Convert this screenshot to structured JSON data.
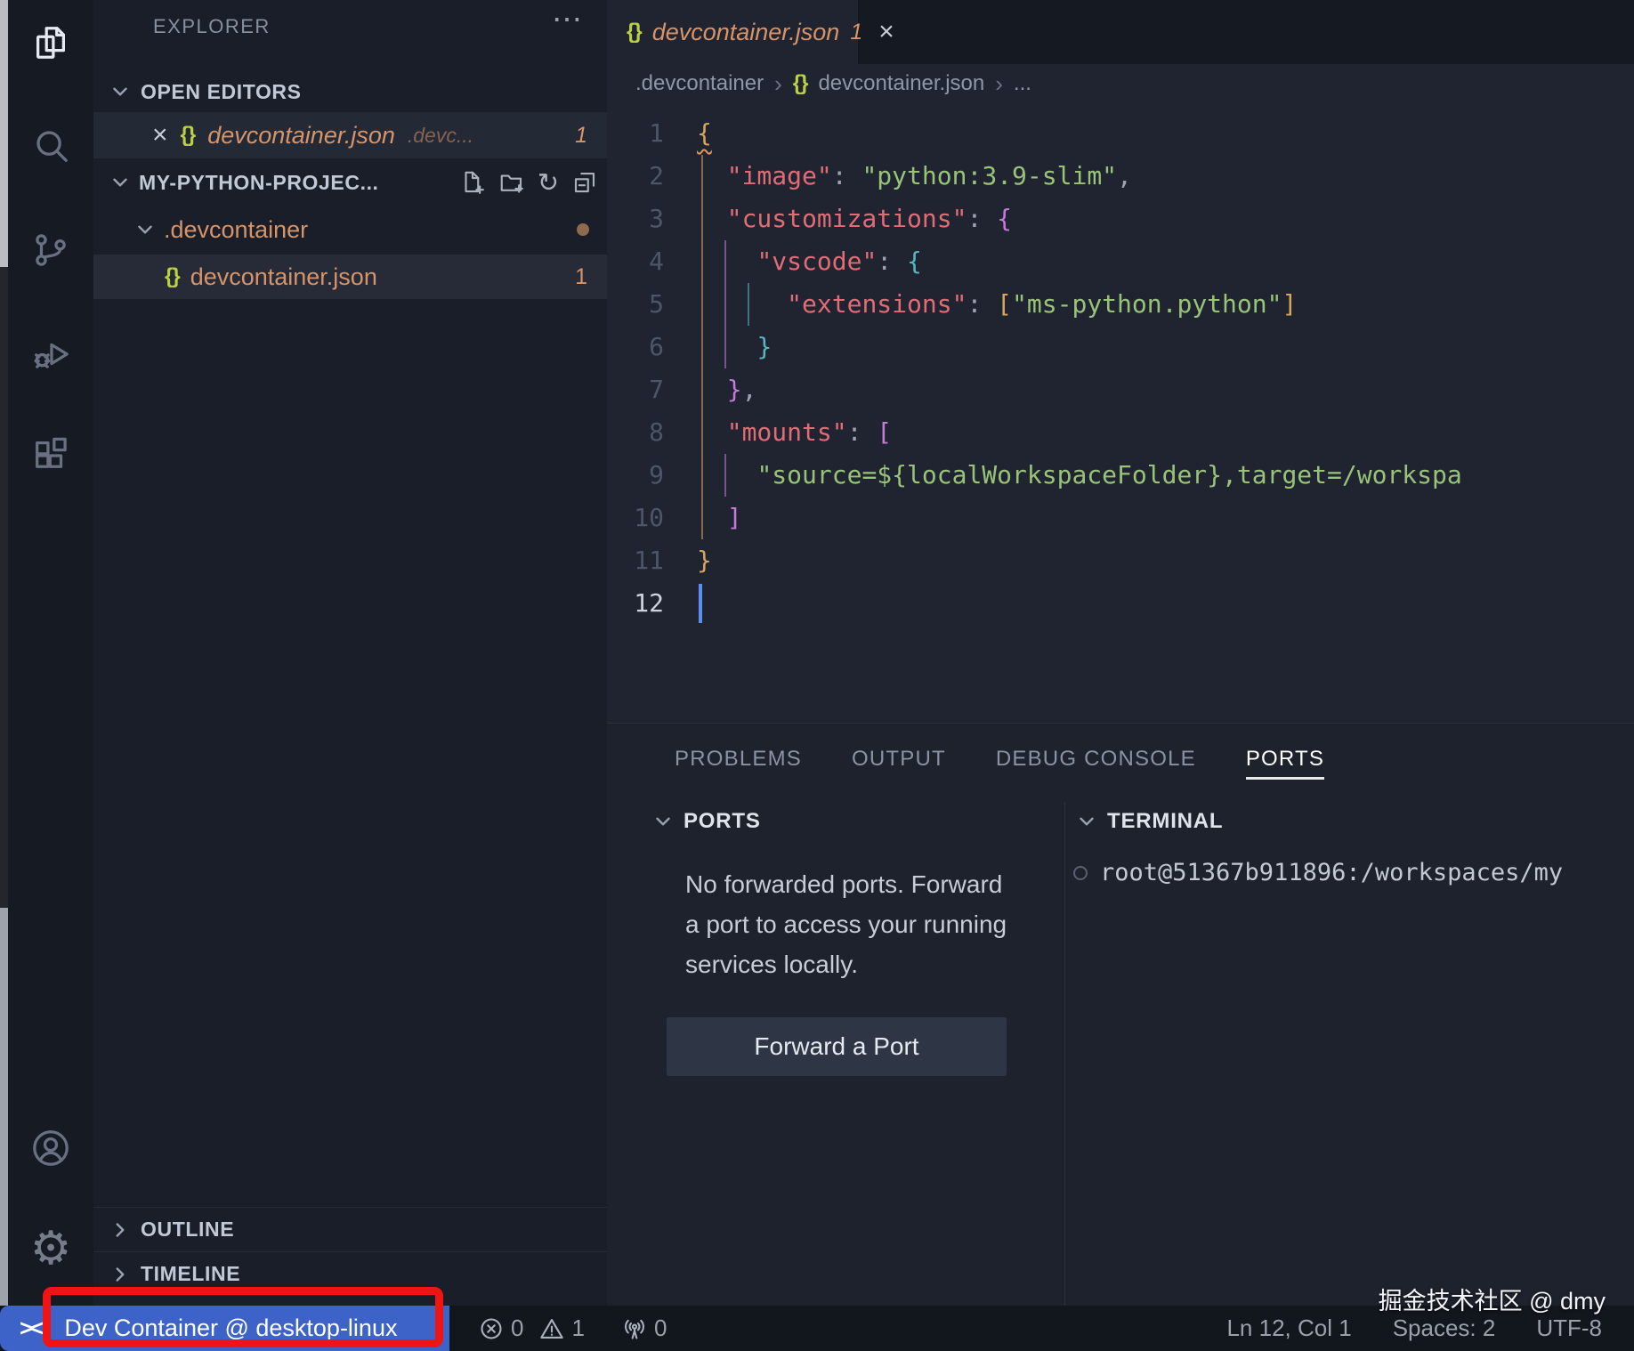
{
  "icons": {
    "json_glyph": "{}",
    "more_glyph": "⋯",
    "refresh_glyph": "↻",
    "close_glyph": "×",
    "remote_glyph": "><",
    "activity_bar_items": [
      "files-icon",
      "search-icon",
      "source-control-icon",
      "run-debug-icon",
      "extensions-icon",
      "account-icon",
      "settings-gear-icon"
    ]
  },
  "sidebar": {
    "title": "EXPLORER",
    "open_editors": {
      "label": "OPEN EDITORS",
      "items": [
        {
          "file": "devcontainer.json",
          "description": ".devc...",
          "badge": "1",
          "modified": true
        }
      ]
    },
    "project": {
      "label": "MY-PYTHON-PROJEC...",
      "toolbar": [
        "new-file-icon",
        "new-folder-icon",
        "refresh-icon",
        "collapse-all-icon"
      ]
    },
    "tree": [
      {
        "label": ".devcontainer",
        "type": "folder",
        "expanded": true,
        "modified_dot": true
      },
      {
        "label": "devcontainer.json",
        "type": "json-file",
        "badge": "1",
        "selected": true
      }
    ],
    "bottom_sections": [
      {
        "label": "OUTLINE"
      },
      {
        "label": "TIMELINE"
      }
    ]
  },
  "editor": {
    "tab": {
      "title": "devcontainer.json",
      "badge": "1"
    },
    "breadcrumb": [
      ".devcontainer",
      "devcontainer.json",
      "..."
    ],
    "code": {
      "language": "json",
      "cursor": {
        "line": 12,
        "col": 1
      },
      "lines": [
        {
          "n": 1,
          "tokens": [
            [
              "{",
              "b1",
              "warn"
            ]
          ]
        },
        {
          "n": 2,
          "tokens": [
            [
              "  ",
              ""
            ],
            [
              "\"image\"",
              "key"
            ],
            [
              ": ",
              "pun"
            ],
            [
              "\"python:3.9-slim\"",
              "str"
            ],
            [
              ",",
              "pun"
            ]
          ]
        },
        {
          "n": 3,
          "tokens": [
            [
              "  ",
              ""
            ],
            [
              "\"customizations\"",
              "key"
            ],
            [
              ": ",
              "pun"
            ],
            [
              "{",
              "b2"
            ]
          ]
        },
        {
          "n": 4,
          "tokens": [
            [
              "    ",
              ""
            ],
            [
              "\"vscode\"",
              "key"
            ],
            [
              ": ",
              "pun"
            ],
            [
              "{",
              "b3"
            ]
          ]
        },
        {
          "n": 5,
          "tokens": [
            [
              "      ",
              ""
            ],
            [
              "\"extensions\"",
              "key"
            ],
            [
              ": ",
              "pun"
            ],
            [
              "[",
              "b1"
            ],
            [
              "\"ms-python.python\"",
              "str"
            ],
            [
              "]",
              "b1"
            ]
          ]
        },
        {
          "n": 6,
          "tokens": [
            [
              "    ",
              ""
            ],
            [
              "}",
              "b3"
            ]
          ]
        },
        {
          "n": 7,
          "tokens": [
            [
              "  ",
              ""
            ],
            [
              "}",
              "b2"
            ],
            [
              ",",
              "pun"
            ]
          ]
        },
        {
          "n": 8,
          "tokens": [
            [
              "  ",
              ""
            ],
            [
              "\"mounts\"",
              "key"
            ],
            [
              ": ",
              "pun"
            ],
            [
              "[",
              "b2"
            ]
          ]
        },
        {
          "n": 9,
          "tokens": [
            [
              "    ",
              ""
            ],
            [
              "\"source=${localWorkspaceFolder},target=/workspa",
              "str"
            ]
          ]
        },
        {
          "n": 10,
          "tokens": [
            [
              "  ",
              ""
            ],
            [
              "]",
              "b2"
            ]
          ]
        },
        {
          "n": 11,
          "tokens": [
            [
              "}",
              "b1"
            ]
          ]
        },
        {
          "n": 12,
          "tokens": []
        }
      ]
    }
  },
  "panel": {
    "tabs": [
      {
        "label": "PROBLEMS",
        "active": false
      },
      {
        "label": "OUTPUT",
        "active": false
      },
      {
        "label": "DEBUG CONSOLE",
        "active": false
      },
      {
        "label": "PORTS",
        "active": true
      }
    ],
    "ports": {
      "header": "PORTS",
      "message_lines": [
        "No forwarded ports. Forward",
        "a port to access your running",
        "services locally."
      ],
      "button": "Forward a Port"
    },
    "terminal": {
      "header": "TERMINAL",
      "line": "root@51367b911896:/workspaces/my"
    }
  },
  "status_bar": {
    "remote": "Dev Container @ desktop-linux",
    "errors": "0",
    "warnings": "1",
    "ports_count": "0",
    "cursor_position": "Ln 12, Col 1",
    "indentation": "Spaces: 2",
    "encoding": "UTF-8"
  },
  "annotation": {
    "shape": "rectangle",
    "color": "#f01414"
  },
  "watermark": "掘金技术社区 @ dmy",
  "colors": {
    "accent_remote_blue": "#3d63c9",
    "modified_orange": "#d59469",
    "json_icon_lime": "#bcd043",
    "key_red": "#e06c75",
    "string_green": "#98c379",
    "bracket_gold": "#d8a65a",
    "bracket_purple": "#c678dd",
    "bracket_cyan": "#56b6c2",
    "annotation_red": "#f01414"
  }
}
